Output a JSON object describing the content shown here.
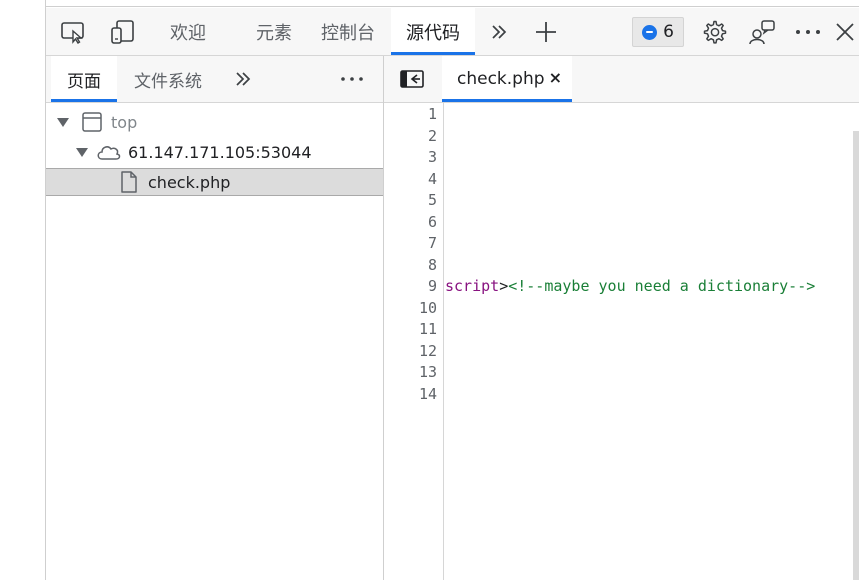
{
  "toolbar": {
    "tabs": [
      {
        "label": "欢迎",
        "active": false
      },
      {
        "label": "元素",
        "active": false
      },
      {
        "label": "控制台",
        "active": false
      },
      {
        "label": "源代码",
        "active": true
      }
    ],
    "issues_count": "6",
    "icons": [
      "inspect-icon",
      "device-toggle-icon",
      "more-tabs-icon",
      "add-tab-icon",
      "issues-icon",
      "settings-icon",
      "feedback-icon",
      "more-options-icon",
      "close-icon"
    ]
  },
  "left_panel": {
    "tabs": [
      {
        "label": "页面",
        "active": true
      },
      {
        "label": "文件系统",
        "active": false
      }
    ],
    "tree": [
      {
        "label": "top",
        "type": "frame",
        "expanded": true
      },
      {
        "label": "61.147.171.105:53044",
        "type": "host",
        "expanded": true
      },
      {
        "label": "check.php",
        "type": "file",
        "selected": true
      }
    ]
  },
  "editor": {
    "tab_label": "check.php",
    "close_label": "×",
    "line_numbers": [
      "1",
      "2",
      "3",
      "4",
      "5",
      "6",
      "7",
      "8",
      "9",
      "10",
      "11",
      "12",
      "13",
      "14"
    ],
    "line9": {
      "tag": "script",
      "punct": ">",
      "comment": "<!--maybe you need a dictionary-->"
    }
  },
  "colors": {
    "accent": "#1a73e8",
    "tag": "#881280",
    "comment": "#1a7f37"
  }
}
